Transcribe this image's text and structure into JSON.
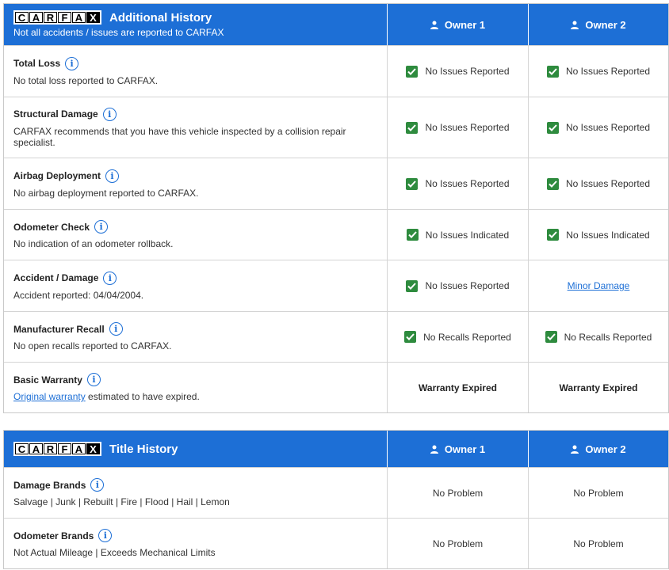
{
  "additional": {
    "brand": [
      "C",
      "A",
      "R",
      "F",
      "A",
      "X"
    ],
    "title": "Additional History",
    "subtitle": "Not all accidents / issues are reported to CARFAX",
    "owner1": "Owner 1",
    "owner2": "Owner 2",
    "rows": [
      {
        "title": "Total Loss",
        "desc": "No total loss reported to CARFAX.",
        "o1": "No Issues Reported",
        "o2": "No Issues Reported"
      },
      {
        "title": "Structural Damage",
        "desc": "CARFAX recommends that you have this vehicle inspected by a collision repair specialist.",
        "o1": "No Issues Reported",
        "o2": "No Issues Reported"
      },
      {
        "title": "Airbag Deployment",
        "desc": "No airbag deployment reported to CARFAX.",
        "o1": "No Issues Reported",
        "o2": "No Issues Reported"
      },
      {
        "title": "Odometer Check",
        "desc": "No indication of an odometer rollback.",
        "o1": "No Issues Indicated",
        "o2": "No Issues Indicated"
      },
      {
        "title": "Accident / Damage",
        "desc": "Accident reported: 04/04/2004.",
        "o1": "No Issues Reported",
        "o2": "Minor Damage"
      },
      {
        "title": "Manufacturer Recall",
        "desc": "No open recalls reported to CARFAX.",
        "o1": "No Recalls Reported",
        "o2": "No Recalls Reported"
      },
      {
        "title": "Basic Warranty",
        "desc_link": "Original warranty",
        "desc_rest": " estimated to have expired.",
        "o1": "Warranty Expired",
        "o2": "Warranty Expired"
      }
    ]
  },
  "title_history": {
    "title": "Title History",
    "owner1": "Owner 1",
    "owner2": "Owner 2",
    "rows": [
      {
        "title": "Damage Brands",
        "desc": "Salvage | Junk | Rebuilt | Fire | Flood | Hail | Lemon",
        "o1": "No Problem",
        "o2": "No Problem"
      },
      {
        "title": "Odometer Brands",
        "desc": "Not Actual Mileage | Exceeds Mechanical Limits",
        "o1": "No Problem",
        "o2": "No Problem"
      }
    ]
  },
  "icons": {
    "info": "info-icon",
    "person": "person-icon",
    "check": "checkmark-icon"
  },
  "colors": {
    "header_blue": "#1d6fd6",
    "check_green": "#2e8b3e",
    "link_blue": "#1d6fd6"
  }
}
